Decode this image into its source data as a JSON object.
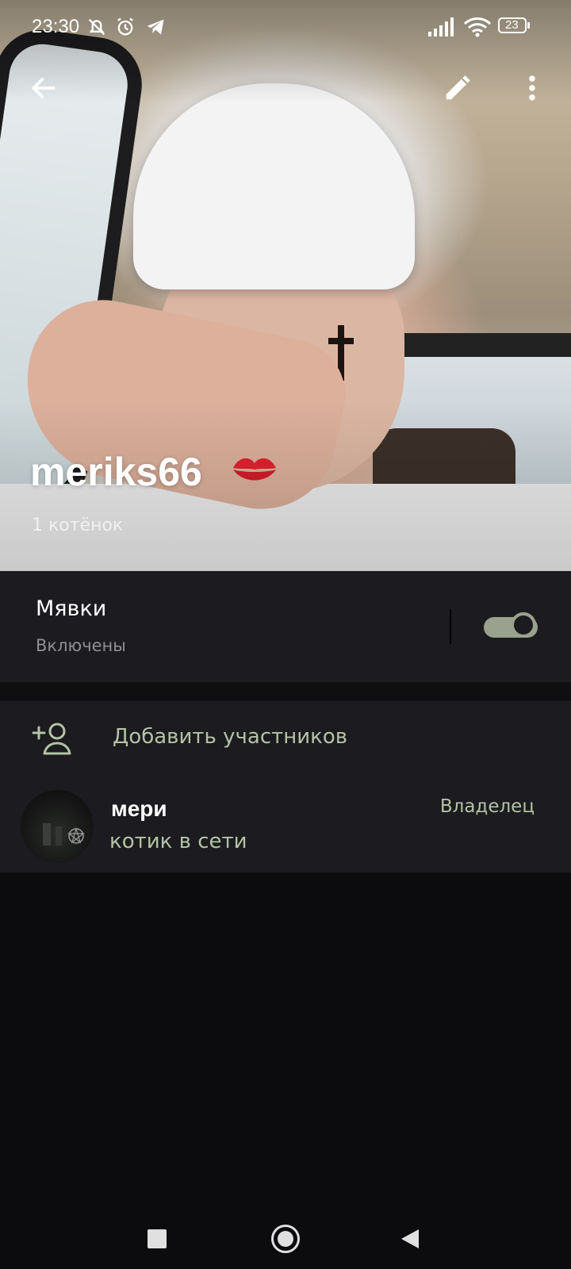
{
  "status_bar": {
    "time": "23:30",
    "battery": "23",
    "icons": [
      "mute-bell-icon",
      "alarm-icon",
      "telegram-icon",
      "signal-icon",
      "wifi-icon",
      "battery-icon"
    ]
  },
  "toolbar": {
    "back_icon": "arrow-left-icon",
    "edit_icon": "pencil-icon",
    "menu_icon": "more-vertical-icon"
  },
  "profile": {
    "title": "meriks66",
    "emoji": "💋",
    "subtitle": "1 котёнок"
  },
  "notifications": {
    "label": "Мявки",
    "status": "Включены",
    "enabled": true,
    "accent": "#9aa28d"
  },
  "members": {
    "add_label": "Добавить участников",
    "list": [
      {
        "name": "мери",
        "status": "котик в сети",
        "role": "Владелец"
      }
    ]
  },
  "nav": {
    "icons": [
      "recents-square-icon",
      "home-circle-icon",
      "back-triangle-icon"
    ]
  },
  "colors": {
    "background": "#0c0b0e",
    "panel": "#1c1b1f",
    "accent_text": "#b4c2a6"
  }
}
